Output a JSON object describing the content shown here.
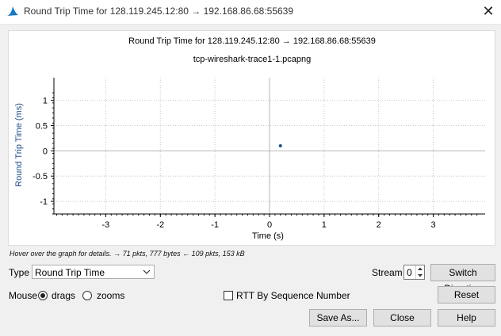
{
  "window": {
    "title": "Round Trip Time for 128.119.245.12:80 → 192.168.86.68:55639",
    "close_glyph": "✕"
  },
  "chart_data": {
    "type": "scatter",
    "title": "Round Trip Time for 128.119.245.12:80 → 192.168.86.68:55639",
    "subtitle": "tcp-wireshark-trace1-1.pcapng",
    "xlabel": "Time (s)",
    "ylabel": "Round Trip Time (ms)",
    "xlim": [
      -3.95,
      3.95
    ],
    "ylim": [
      -1.25,
      1.45
    ],
    "x_ticks": [
      -3,
      -2,
      -1,
      0,
      1,
      2,
      3
    ],
    "y_ticks": [
      -1,
      -0.5,
      0,
      0.5,
      1
    ],
    "grid": true,
    "series": [
      {
        "x": [
          0.2
        ],
        "y": [
          0.1
        ],
        "color": "#1f4e8c"
      }
    ],
    "axis_color": "#000000",
    "grid_color": "#c8c8c8",
    "zero_line_color": "#b4b4b4"
  },
  "info": {
    "hint": "Hover over the graph for details. → 71 pkts, 777 bytes ← 109 pkts, 153 kB"
  },
  "controls": {
    "type_label": "Type",
    "type_value": "Round Trip Time",
    "stream_label": "Stream",
    "stream_value": "0",
    "switch_direction": "Switch Direction",
    "mouse_label": "Mouse",
    "drags_label": "drags",
    "zooms_label": "zooms",
    "mouse_mode": "drags",
    "rtt_seq_label": "RTT By Sequence Number",
    "rtt_seq_checked": false,
    "reset": "Reset",
    "save_as": "Save As...",
    "close": "Close",
    "help": "Help"
  }
}
